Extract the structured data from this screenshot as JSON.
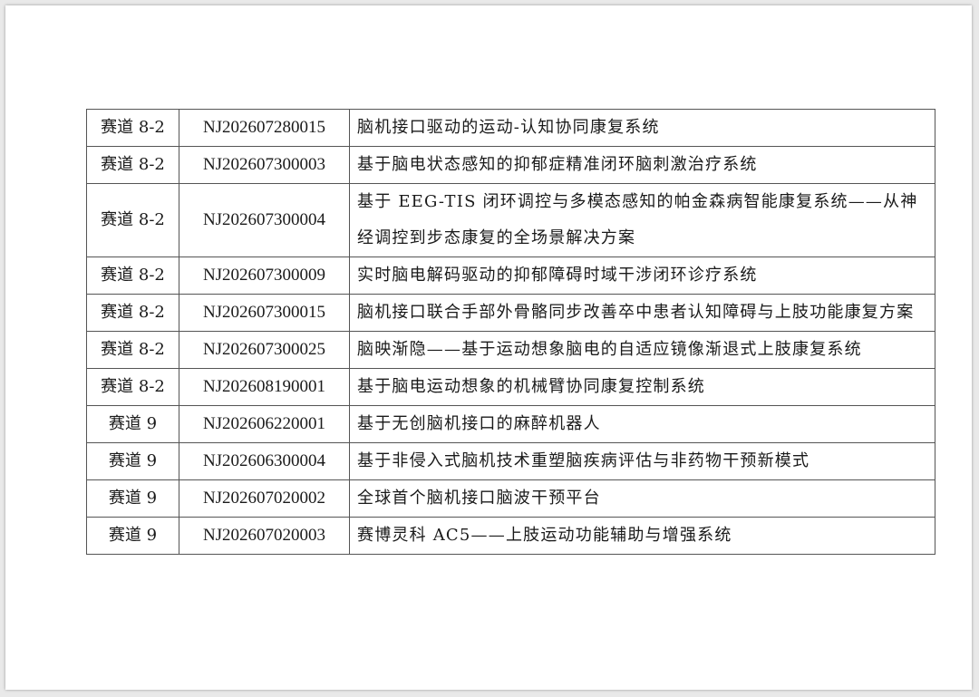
{
  "table": {
    "rows": [
      {
        "track": "赛道 8-2",
        "code": "NJ202607280015",
        "name": "脑机接口驱动的运动-认知协同康复系统"
      },
      {
        "track": "赛道 8-2",
        "code": "NJ202607300003",
        "name": "基于脑电状态感知的抑郁症精准闭环脑刺激治疗系统"
      },
      {
        "track": "赛道 8-2",
        "code": "NJ202607300004",
        "name": "基于 EEG-TIS 闭环调控与多模态感知的帕金森病智能康复系统——从神经调控到步态康复的全场景解决方案"
      },
      {
        "track": "赛道 8-2",
        "code": "NJ202607300009",
        "name": "实时脑电解码驱动的抑郁障碍时域干涉闭环诊疗系统"
      },
      {
        "track": "赛道 8-2",
        "code": "NJ202607300015",
        "name": "脑机接口联合手部外骨骼同步改善卒中患者认知障碍与上肢功能康复方案"
      },
      {
        "track": "赛道 8-2",
        "code": "NJ202607300025",
        "name": "脑映渐隐——基于运动想象脑电的自适应镜像渐退式上肢康复系统"
      },
      {
        "track": "赛道 8-2",
        "code": "NJ202608190001",
        "name": "基于脑电运动想象的机械臂协同康复控制系统"
      },
      {
        "track": "赛道 9",
        "code": "NJ202606220001",
        "name": "基于无创脑机接口的麻醉机器人"
      },
      {
        "track": "赛道 9",
        "code": "NJ202606300004",
        "name": "基于非侵入式脑机技术重塑脑疾病评估与非药物干预新模式"
      },
      {
        "track": "赛道 9",
        "code": "NJ202607020002",
        "name": "全球首个脑机接口脑波干预平台"
      },
      {
        "track": "赛道 9",
        "code": "NJ202607020003",
        "name": "赛博灵科 AC5——上肢运动功能辅助与增强系统"
      }
    ]
  }
}
